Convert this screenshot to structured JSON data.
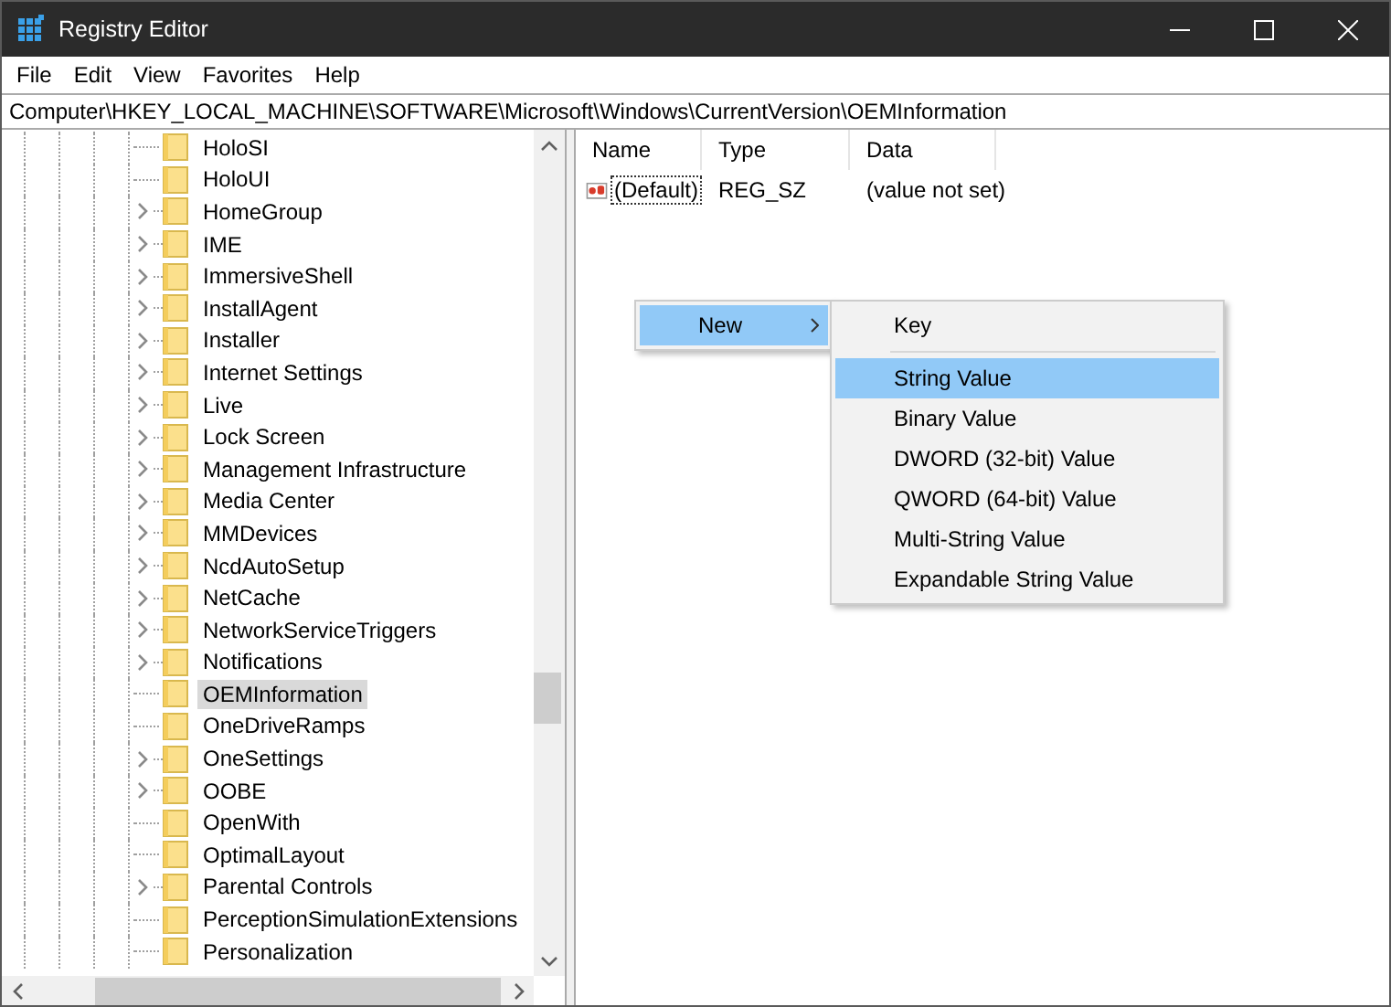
{
  "window": {
    "title": "Registry Editor"
  },
  "menu_bar": [
    "File",
    "Edit",
    "View",
    "Favorites",
    "Help"
  ],
  "address": "Computer\\HKEY_LOCAL_MACHINE\\SOFTWARE\\Microsoft\\Windows\\CurrentVersion\\OEMInformation",
  "tree": {
    "items": [
      {
        "label": "HoloSI",
        "expandable": false,
        "selected": false
      },
      {
        "label": "HoloUI",
        "expandable": false,
        "selected": false
      },
      {
        "label": "HomeGroup",
        "expandable": true,
        "selected": false
      },
      {
        "label": "IME",
        "expandable": true,
        "selected": false
      },
      {
        "label": "ImmersiveShell",
        "expandable": true,
        "selected": false
      },
      {
        "label": "InstallAgent",
        "expandable": true,
        "selected": false
      },
      {
        "label": "Installer",
        "expandable": true,
        "selected": false
      },
      {
        "label": "Internet Settings",
        "expandable": true,
        "selected": false
      },
      {
        "label": "Live",
        "expandable": true,
        "selected": false
      },
      {
        "label": "Lock Screen",
        "expandable": true,
        "selected": false
      },
      {
        "label": "Management Infrastructure",
        "expandable": true,
        "selected": false
      },
      {
        "label": "Media Center",
        "expandable": true,
        "selected": false
      },
      {
        "label": "MMDevices",
        "expandable": true,
        "selected": false
      },
      {
        "label": "NcdAutoSetup",
        "expandable": true,
        "selected": false
      },
      {
        "label": "NetCache",
        "expandable": true,
        "selected": false
      },
      {
        "label": "NetworkServiceTriggers",
        "expandable": true,
        "selected": false
      },
      {
        "label": "Notifications",
        "expandable": true,
        "selected": false
      },
      {
        "label": "OEMInformation",
        "expandable": false,
        "selected": true
      },
      {
        "label": "OneDriveRamps",
        "expandable": false,
        "selected": false
      },
      {
        "label": "OneSettings",
        "expandable": true,
        "selected": false
      },
      {
        "label": "OOBE",
        "expandable": true,
        "selected": false
      },
      {
        "label": "OpenWith",
        "expandable": false,
        "selected": false
      },
      {
        "label": "OptimalLayout",
        "expandable": false,
        "selected": false
      },
      {
        "label": "Parental Controls",
        "expandable": true,
        "selected": false
      },
      {
        "label": "PerceptionSimulationExtensions",
        "expandable": false,
        "selected": false
      },
      {
        "label": "Personalization",
        "expandable": false,
        "selected": false
      }
    ]
  },
  "values": {
    "columns": [
      "Name",
      "Type",
      "Data"
    ],
    "rows": [
      {
        "name": "(Default)",
        "type": "REG_SZ",
        "data": "(value not set)",
        "focused": true
      }
    ]
  },
  "context_menu": {
    "items": [
      {
        "label": "New",
        "selected": true,
        "submenu": true
      }
    ]
  },
  "submenu": {
    "items": [
      {
        "label": "Key",
        "selected": false,
        "separator_after": true
      },
      {
        "label": "String Value",
        "selected": true,
        "separator_after": false
      },
      {
        "label": "Binary Value",
        "selected": false,
        "separator_after": false
      },
      {
        "label": "DWORD (32-bit) Value",
        "selected": false,
        "separator_after": false
      },
      {
        "label": "QWORD (64-bit) Value",
        "selected": false,
        "separator_after": false
      },
      {
        "label": "Multi-String Value",
        "selected": false,
        "separator_after": false
      },
      {
        "label": "Expandable String Value",
        "selected": false,
        "separator_after": false
      }
    ]
  }
}
